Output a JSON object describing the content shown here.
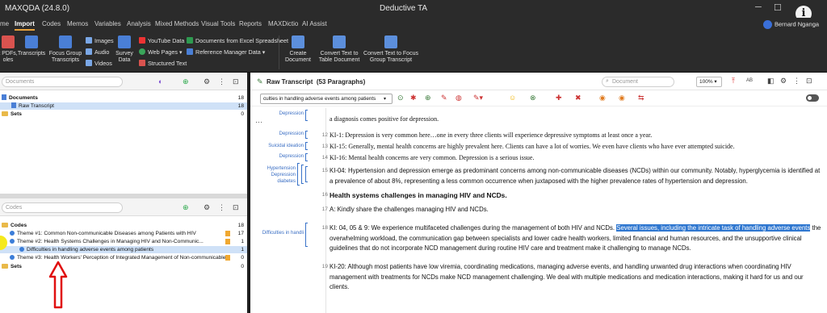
{
  "window": {
    "app": "MAXQDA (24.8.0)",
    "document": "Deductive TA",
    "user": "Bernard Nganga"
  },
  "menu": [
    "me",
    "Import",
    "Codes",
    "Memos",
    "Variables",
    "Analysis",
    "Mixed Methods",
    "Visual Tools",
    "Reports",
    "MAXDictio",
    "AI Assist"
  ],
  "ribbon": {
    "pdfs": "t PDFs,\noles",
    "transcripts": "Transcripts",
    "focus_group": "Focus Group\nTranscripts",
    "images": "Images",
    "audio": "Audio",
    "videos": "Videos",
    "survey": "Survey\nData",
    "youtube": "YouTube Data",
    "webpages": "Web Pages",
    "structured": "Structured Text",
    "excel": "Documents from Excel Spreadsheet",
    "refmgr": "Reference Manager Data",
    "create_doc": "Create\nDocument",
    "convert_table": "Convert Text to\nTable Document",
    "convert_fg": "Convert Text to Focus\nGroup Transcript"
  },
  "documents": {
    "search_placeholder": "Documents",
    "rows": [
      {
        "label": "Documents",
        "count": "18"
      },
      {
        "label": "Raw Transcript",
        "count": "18"
      },
      {
        "label": "Sets",
        "count": "0"
      }
    ]
  },
  "codes": {
    "search_placeholder": "Codes",
    "rows": [
      {
        "label": "Codes",
        "count": "18"
      },
      {
        "label": "Theme #1: Common Non-communicable Diseases among Patients with HIV",
        "count": "17"
      },
      {
        "label": "Theme #2: Health Systems Challenges in Managing HIV  and Non-Communic...",
        "count": "1"
      },
      {
        "label": "Difficulties in handling adverse events among patients",
        "count": "1"
      },
      {
        "label": "Theme #3: Health Workers' Perception of Integrated Management of Non-communicable...",
        "count": "0"
      },
      {
        "label": "Sets",
        "count": "0"
      }
    ]
  },
  "browser": {
    "title": "Raw Transcript",
    "subtitle": "(53 Paragraphs)",
    "search_placeholder": "Document",
    "zoom": "100%",
    "code_select": "culties in handling adverse events among patients",
    "tags": [
      "Depression",
      "Depression",
      "Suicidal ideation",
      "Depression",
      "Hypertension",
      "Depression",
      "diabetes",
      "Difficulties in handli"
    ],
    "paragraphs": [
      {
        "num": "",
        "text": "a diagnosis comes positive for depression."
      },
      {
        "num": "12",
        "text": "KI-1: Depression is very common here…one in every three clients will experience depressive symptoms at least once a year."
      },
      {
        "num": "13",
        "text": "KI-15: Generally, mental health concerns are highly prevalent here. Clients can have a lot of worries. We even have clients who have ever attempted suicide."
      },
      {
        "num": "14",
        "text": "KI-16: Mental health concerns are very common. Depression is a serious issue."
      },
      {
        "num": "15",
        "text": "KI-04: Hypertension and depression emerge as predominant concerns among non-communicable diseases (NCDs) within our community. Notably, hyperglycemia is identified at a prevalence of about 8%, representing a less common occurrence when juxtaposed with the higher prevalence rates of hypertension and depression."
      },
      {
        "num": "16",
        "text": "Health systems challenges in managing HIV  and NCDs."
      },
      {
        "num": "17",
        "text": "A: Kindly share the challenges managing HIV and NCDs."
      },
      {
        "num": "18",
        "pre": "KI: 04, 05 & 9: We experience multifaceted challenges during the management of both HIV and NCDs. ",
        "hl": "Several issues, including the intricate task of handling adverse events",
        "post": " the overwhelming workload, the communication gap between specialists and lower cadre health workers, limited financial and human resources, and the unsupportive clinical guidelines that do not incorporate NCD management during routine HIV care and treatment make it challenging to manage NCDs."
      },
      {
        "num": "19",
        "text": "KI-20: Although most patients have low viremia, coordinating medications, managing adverse events, and handling unwanted drug interactions when coordinating HIV management with treatments for NCDs make NCD management challenging. We deal with multiple medications and medication interactions, making it hard for us and our clients."
      }
    ]
  },
  "colors": {
    "highlight": "#2f77d0",
    "code_tag": "#3b6fc4",
    "arrow": "#e01010",
    "folder": "#e9b949"
  }
}
